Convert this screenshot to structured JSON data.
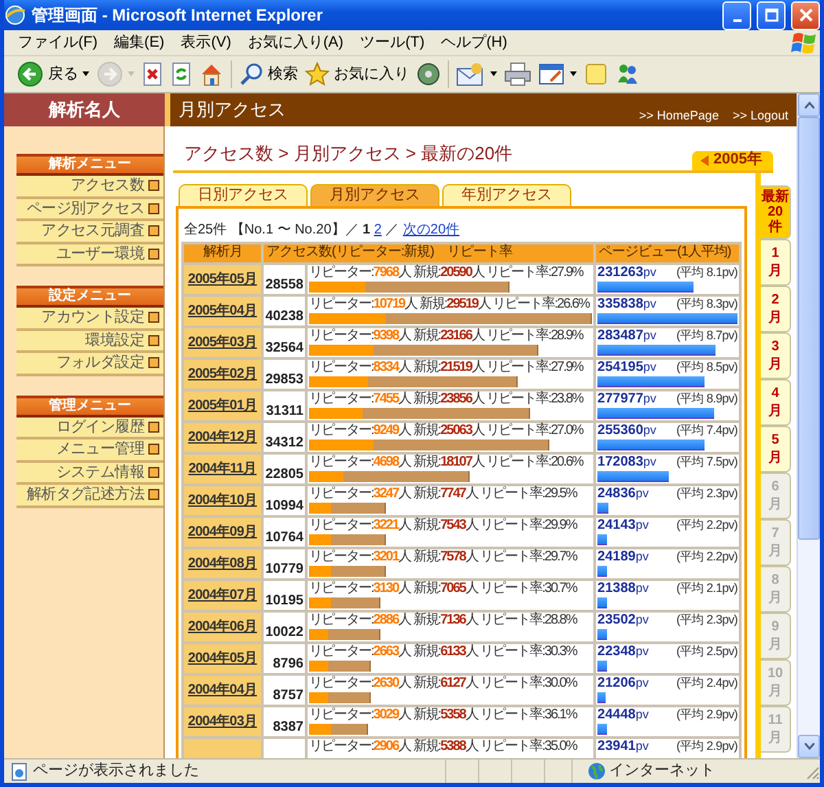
{
  "window": {
    "title": "管理画面 - Microsoft Internet Explorer"
  },
  "menu_bar": [
    "ファイル(F)",
    "編集(E)",
    "表示(V)",
    "お気に入り(A)",
    "ツール(T)",
    "ヘルプ(H)"
  ],
  "toolbar_groups": [
    [
      {
        "kind": "back",
        "label": "戻る",
        "has_menu": true,
        "disabled": false
      },
      {
        "kind": "forward",
        "has_menu": true,
        "disabled": true
      },
      {
        "kind": "stop",
        "has_menu": false,
        "disabled": false
      },
      {
        "kind": "refresh",
        "has_menu": false,
        "disabled": false
      },
      {
        "kind": "home",
        "has_menu": false,
        "disabled": false
      }
    ],
    [
      {
        "kind": "search",
        "label": "検索",
        "has_menu": false,
        "disabled": false
      },
      {
        "kind": "favorites",
        "label": "お気に入り",
        "has_menu": false,
        "disabled": false
      },
      {
        "kind": "media",
        "has_menu": false,
        "disabled": false
      }
    ],
    [
      {
        "kind": "mail",
        "has_menu": true,
        "disabled": false
      },
      {
        "kind": "print",
        "has_menu": false,
        "disabled": false
      },
      {
        "kind": "edit",
        "has_menu": true,
        "disabled": false
      },
      {
        "kind": "note",
        "has_menu": false,
        "disabled": false
      },
      {
        "kind": "messenger",
        "has_menu": false,
        "disabled": false
      }
    ]
  ],
  "page_header": {
    "logo": "解析名人",
    "title": "月別アクセス",
    "links": [
      ">> HomePage",
      ">> Logout"
    ]
  },
  "sidebar": [
    {
      "title": "解析メニュー",
      "items": [
        "アクセス数",
        "ページ別アクセス",
        "アクセス元調査",
        "ユーザー環境"
      ]
    },
    {
      "title": "設定メニュー",
      "items": [
        "アカウント設定",
        "環境設定",
        "フォルダ設定"
      ]
    },
    {
      "title": "管理メニュー",
      "items": [
        "ログイン履歴",
        "メニュー管理",
        "システム情報",
        "解析タグ記述方法"
      ]
    }
  ],
  "breadcrumb": "アクセス数 > 月別アクセス > 最新の20件",
  "year_tab": "2005年",
  "tabs": [
    {
      "label": "日別アクセス",
      "selected": false
    },
    {
      "label": "月別アクセス",
      "selected": true
    },
    {
      "label": "年別アクセス",
      "selected": false
    }
  ],
  "pager": {
    "summary": "全25件 【No.1 〜 No.20】／",
    "pages": [
      {
        "label": "1",
        "selected": true
      },
      {
        "label": "2",
        "selected": false
      }
    ],
    "separator": "／",
    "next": "次の20件"
  },
  "table": {
    "columns": [
      "解析月",
      "アクセス数(リピーター:新規)　リピート率",
      "ページビュー(1人平均)"
    ],
    "rows": [
      {
        "month": "2005年05月",
        "visits": "28558",
        "stats": "リピーター:**7968**人 新規:**20590**人 リピート率:27.9%",
        "visits_bar": {
          "level": 0.71
        },
        "repeater_bar": {
          "level": 0.2
        },
        "pageviews": "**231263**pv",
        "average": "(平均 8.1pv)",
        "pageview_bar": {
          "level": 0.69
        }
      },
      {
        "month": "2005年04月",
        "visits": "40238",
        "stats": "リピーター:**10719**人 新規:**29519**人 リピート率:26.6%",
        "visits_bar": {
          "level": 1
        },
        "repeater_bar": {
          "level": 0.27
        },
        "pageviews": "**335838**pv",
        "average": "(平均 8.3pv)",
        "pageview_bar": {
          "level": 1
        }
      },
      {
        "month": "2005年03月",
        "visits": "32564",
        "stats": "リピーター:**9398**人 新規:**23166**人 リピート率:28.9%",
        "visits_bar": {
          "level": 0.81
        },
        "repeater_bar": {
          "level": 0.23
        },
        "pageviews": "**283487**pv",
        "average": "(平均 8.7pv)",
        "pageview_bar": {
          "level": 0.84
        }
      },
      {
        "month": "2005年02月",
        "visits": "29853",
        "stats": "リピーター:**8334**人 新規:**21519**人 リピート率:27.9%",
        "visits_bar": {
          "level": 0.74
        },
        "repeater_bar": {
          "level": 0.21
        },
        "pageviews": "**254195**pv",
        "average": "(平均 8.5pv)",
        "pageview_bar": {
          "level": 0.76
        }
      },
      {
        "month": "2005年01月",
        "visits": "31311",
        "stats": "リピーター:**7455**人 新規:**23856**人 リピート率:23.8%",
        "visits_bar": {
          "level": 0.78
        },
        "repeater_bar": {
          "level": 0.19
        },
        "pageviews": "**277977**pv",
        "average": "(平均 8.9pv)",
        "pageview_bar": {
          "level": 0.83
        }
      },
      {
        "month": "2004年12月",
        "visits": "34312",
        "stats": "リピーター:**9249**人 新規:**25063**人 リピート率:27.0%",
        "visits_bar": {
          "level": 0.85
        },
        "repeater_bar": {
          "level": 0.23
        },
        "pageviews": "**255360**pv",
        "average": "(平均 7.4pv)",
        "pageview_bar": {
          "level": 0.76
        }
      },
      {
        "month": "2004年11月",
        "visits": "22805",
        "stats": "リピーター:**4698**人 新規:**18107**人 リピート率:20.6%",
        "visits_bar": {
          "level": 0.57
        },
        "repeater_bar": {
          "level": 0.12
        },
        "pageviews": "**172083**pv",
        "average": "(平均 7.5pv)",
        "pageview_bar": {
          "level": 0.51
        }
      },
      {
        "month": "2004年10月",
        "visits": "10994",
        "stats": "リピーター:**3247**人 新規:**7747**人 リピート率:29.5%",
        "visits_bar": {
          "level": 0.27
        },
        "repeater_bar": {
          "level": 0.08
        },
        "pageviews": "**24836**pv",
        "average": "(平均 2.3pv)",
        "pageview_bar": {
          "level": 0.074
        }
      },
      {
        "month": "2004年09月",
        "visits": "10764",
        "stats": "リピーター:**3221**人 新規:**7543**人 リピート率:29.9%",
        "visits_bar": {
          "level": 0.27
        },
        "repeater_bar": {
          "level": 0.08
        },
        "pageviews": "**24143**pv",
        "average": "(平均 2.2pv)",
        "pageview_bar": {
          "level": 0.072
        }
      },
      {
        "month": "2004年08月",
        "visits": "10779",
        "stats": "リピーター:**3201**人 新規:**7578**人 リピート率:29.7%",
        "visits_bar": {
          "level": 0.27
        },
        "repeater_bar": {
          "level": 0.08
        },
        "pageviews": "**24189**pv",
        "average": "(平均 2.2pv)",
        "pageview_bar": {
          "level": 0.072
        }
      },
      {
        "month": "2004年07月",
        "visits": "10195",
        "stats": "リピーター:**3130**人 新規:**7065**人 リピート率:30.7%",
        "visits_bar": {
          "level": 0.25
        },
        "repeater_bar": {
          "level": 0.08
        },
        "pageviews": "**21388**pv",
        "average": "(平均 2.1pv)",
        "pageview_bar": {
          "level": 0.064
        }
      },
      {
        "month": "2004年06月",
        "visits": "10022",
        "stats": "リピーター:**2886**人 新規:**7136**人 リピート率:28.8%",
        "visits_bar": {
          "level": 0.25
        },
        "repeater_bar": {
          "level": 0.07
        },
        "pageviews": "**23502**pv",
        "average": "(平均 2.3pv)",
        "pageview_bar": {
          "level": 0.07
        }
      },
      {
        "month": "2004年05月",
        "visits": "8796",
        "stats": "リピーター:**2663**人 新規:**6133**人 リピート率:30.3%",
        "visits_bar": {
          "level": 0.22
        },
        "repeater_bar": {
          "level": 0.07
        },
        "pageviews": "**22348**pv",
        "average": "(平均 2.5pv)",
        "pageview_bar": {
          "level": 0.067
        }
      },
      {
        "month": "2004年04月",
        "visits": "8757",
        "stats": "リピーター:**2630**人 新規:**6127**人 リピート率:30.0%",
        "visits_bar": {
          "level": 0.22
        },
        "repeater_bar": {
          "level": 0.07
        },
        "pageviews": "**21206**pv",
        "average": "(平均 2.4pv)",
        "pageview_bar": {
          "level": 0.063
        }
      },
      {
        "month": "2004年03月",
        "visits": "8387",
        "stats": "リピーター:**3029**人 新規:**5358**人 リピート率:36.1%",
        "visits_bar": {
          "level": 0.21
        },
        "repeater_bar": {
          "level": 0.08
        },
        "pageviews": "**24448**pv",
        "average": "(平均 2.9pv)",
        "pageview_bar": {
          "level": 0.073
        }
      },
      {
        "stats": "リピーター:**2906**人 新規:**5388**人 リピート率:35.0%",
        "pageviews": "**23941**pv",
        "average": "(平均 2.9pv)"
      }
    ]
  },
  "month_tabs": [
    {
      "lines": [
        "最新",
        "20",
        "件"
      ],
      "selected": true,
      "disabled": false
    },
    {
      "lines": [
        "1",
        "月"
      ],
      "selected": false,
      "disabled": false
    },
    {
      "lines": [
        "2",
        "月"
      ],
      "selected": false,
      "disabled": false
    },
    {
      "lines": [
        "3",
        "月"
      ],
      "selected": false,
      "disabled": false
    },
    {
      "lines": [
        "4",
        "月"
      ],
      "selected": false,
      "disabled": false
    },
    {
      "lines": [
        "5",
        "月"
      ],
      "selected": false,
      "disabled": false
    },
    {
      "lines": [
        "6",
        "月"
      ],
      "selected": false,
      "disabled": true
    },
    {
      "lines": [
        "7",
        "月"
      ],
      "selected": false,
      "disabled": true
    },
    {
      "lines": [
        "8",
        "月"
      ],
      "selected": false,
      "disabled": true
    },
    {
      "lines": [
        "9",
        "月"
      ],
      "selected": false,
      "disabled": true
    },
    {
      "lines": [
        "10",
        "月"
      ],
      "selected": false,
      "disabled": true
    },
    {
      "lines": [
        "11",
        "月"
      ],
      "selected": false,
      "disabled": true
    }
  ],
  "status_bar": {
    "text": "ページが表示されました",
    "zone": "インターネット"
  }
}
